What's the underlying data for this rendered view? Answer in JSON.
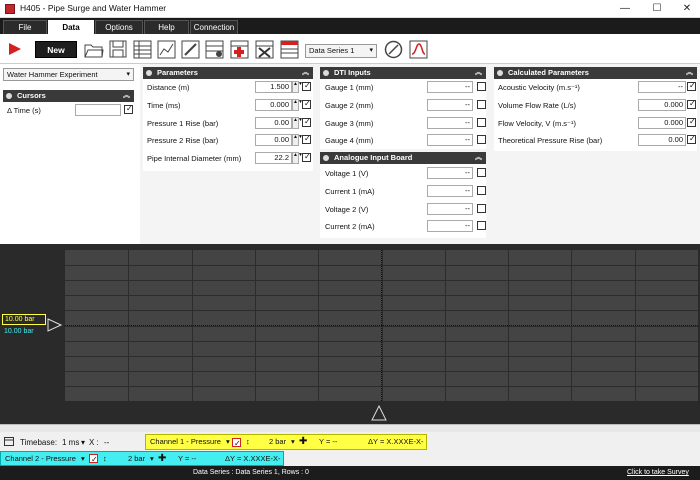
{
  "window": {
    "title": "H405 - Pipe Surge and Water Hammer"
  },
  "menu": {
    "tabs": [
      "File",
      "Data",
      "Options",
      "Help",
      "Connection"
    ],
    "active": "Data"
  },
  "toolbar": {
    "new_label": "New",
    "series_value": "Data Series 1"
  },
  "experiment_select": {
    "value": "Water Hammer Experiment"
  },
  "cursors": {
    "title": "Cursors",
    "delta_time_label": "Δ Time (s)",
    "delta_time_value": ""
  },
  "parameters": {
    "title": "Parameters",
    "rows": [
      {
        "label": "Distance (m)",
        "value": "1.500"
      },
      {
        "label": "Time (ms)",
        "value": "0.000"
      },
      {
        "label": "Pressure 1 Rise (bar)",
        "value": "0.00"
      },
      {
        "label": "Pressure 2 Rise (bar)",
        "value": "0.00"
      },
      {
        "label": "Pipe Internal Diameter (mm)",
        "value": "22.2"
      }
    ]
  },
  "dti": {
    "title": "DTI Inputs",
    "rows": [
      {
        "label": "Gauge 1 (mm)",
        "value": "--"
      },
      {
        "label": "Gauge 2 (mm)",
        "value": "--"
      },
      {
        "label": "Gauge 3 (mm)",
        "value": "--"
      },
      {
        "label": "Gauge 4 (mm)",
        "value": "--"
      }
    ]
  },
  "analogue": {
    "title": "Analogue Input Board",
    "rows": [
      {
        "label": "Voltage 1 (V)",
        "value": "--"
      },
      {
        "label": "Current 1 (mA)",
        "value": "--"
      },
      {
        "label": "Voltage 2 (V)",
        "value": "--"
      },
      {
        "label": "Current 2 (mA)",
        "value": "--"
      }
    ]
  },
  "calculated": {
    "title": "Calculated Parameters",
    "rows": [
      {
        "label": "Acoustic Velocity (m.s⁻¹)",
        "value": "--"
      },
      {
        "label": "Volume Flow Rate (L/s)",
        "value": "0.000"
      },
      {
        "label": "Flow Velocity, V (m.s⁻¹)",
        "value": "0.000"
      },
      {
        "label": "Theoretical Pressure Rise (bar)",
        "value": "0.00"
      }
    ]
  },
  "scope": {
    "marker_ch1": "10.00 bar",
    "marker_ch2": "10.00 bar"
  },
  "timebase": {
    "label": "Timebase:",
    "value": "1 ms",
    "x_label": "X :",
    "x_value": "--"
  },
  "channel1": {
    "name": "Channel 1 - Pressure",
    "scale": "2 bar",
    "y": "Y = --",
    "dy": "ΔY = X.XXXE-X-"
  },
  "channel2": {
    "name": "Channel 2 - Pressure",
    "scale": "2 bar",
    "y": "Y = --",
    "dy": "ΔY = X.XXXE-X-"
  },
  "status": {
    "series_info": "Data Series : Data Series 1,  Rows : 0",
    "survey_link": "Click to take Survey"
  },
  "colors": {
    "ch1": "#ffff44",
    "ch2": "#44eef0",
    "accent": "#c0282d"
  }
}
